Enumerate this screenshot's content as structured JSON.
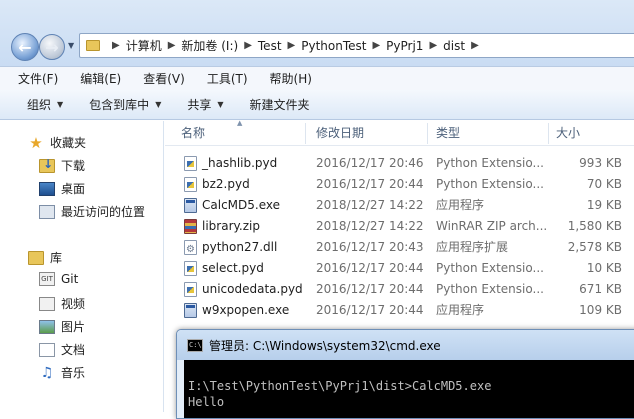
{
  "address": {
    "crumbs": [
      "计算机",
      "新加卷 (I:)",
      "Test",
      "PythonTest",
      "PyPrj1",
      "dist"
    ]
  },
  "menu": [
    "文件(F)",
    "编辑(E)",
    "查看(V)",
    "工具(T)",
    "帮助(H)"
  ],
  "toolbar": {
    "organize": "组织",
    "include_in_library": "包含到库中",
    "share": "共享",
    "new_folder": "新建文件夹"
  },
  "sidebar": {
    "favorites": "收藏夹",
    "downloads": "下载",
    "desktop": "桌面",
    "recent": "最近访问的位置",
    "libraries": "库",
    "git": "Git",
    "videos": "视频",
    "pictures": "图片",
    "documents": "文档",
    "music": "音乐"
  },
  "columns": {
    "name": "名称",
    "modified": "修改日期",
    "type": "类型",
    "size": "大小"
  },
  "files": [
    {
      "name": "_hashlib.pyd",
      "date": "2016/12/17 20:46",
      "type": "Python Extensio...",
      "size": "993 KB",
      "icon": "pyd"
    },
    {
      "name": "bz2.pyd",
      "date": "2016/12/17 20:44",
      "type": "Python Extensio...",
      "size": "70 KB",
      "icon": "pyd"
    },
    {
      "name": "CalcMD5.exe",
      "date": "2018/12/27 14:22",
      "type": "应用程序",
      "size": "19 KB",
      "icon": "exe"
    },
    {
      "name": "library.zip",
      "date": "2018/12/27 14:22",
      "type": "WinRAR ZIP arch...",
      "size": "1,580 KB",
      "icon": "zip"
    },
    {
      "name": "python27.dll",
      "date": "2016/12/17 20:43",
      "type": "应用程序扩展",
      "size": "2,578 KB",
      "icon": "dll"
    },
    {
      "name": "select.pyd",
      "date": "2016/12/17 20:44",
      "type": "Python Extensio...",
      "size": "10 KB",
      "icon": "pyd"
    },
    {
      "name": "unicodedata.pyd",
      "date": "2016/12/17 20:44",
      "type": "Python Extensio...",
      "size": "671 KB",
      "icon": "pyd"
    },
    {
      "name": "w9xpopen.exe",
      "date": "2016/12/17 20:44",
      "type": "应用程序",
      "size": "109 KB",
      "icon": "exe"
    }
  ],
  "cmd": {
    "title": "管理员: C:\\Windows\\system32\\cmd.exe",
    "icon_text": "C:\\",
    "line1": "I:\\Test\\PythonTest\\PyPrj1\\dist>CalcMD5.exe",
    "line2": "Hello"
  }
}
